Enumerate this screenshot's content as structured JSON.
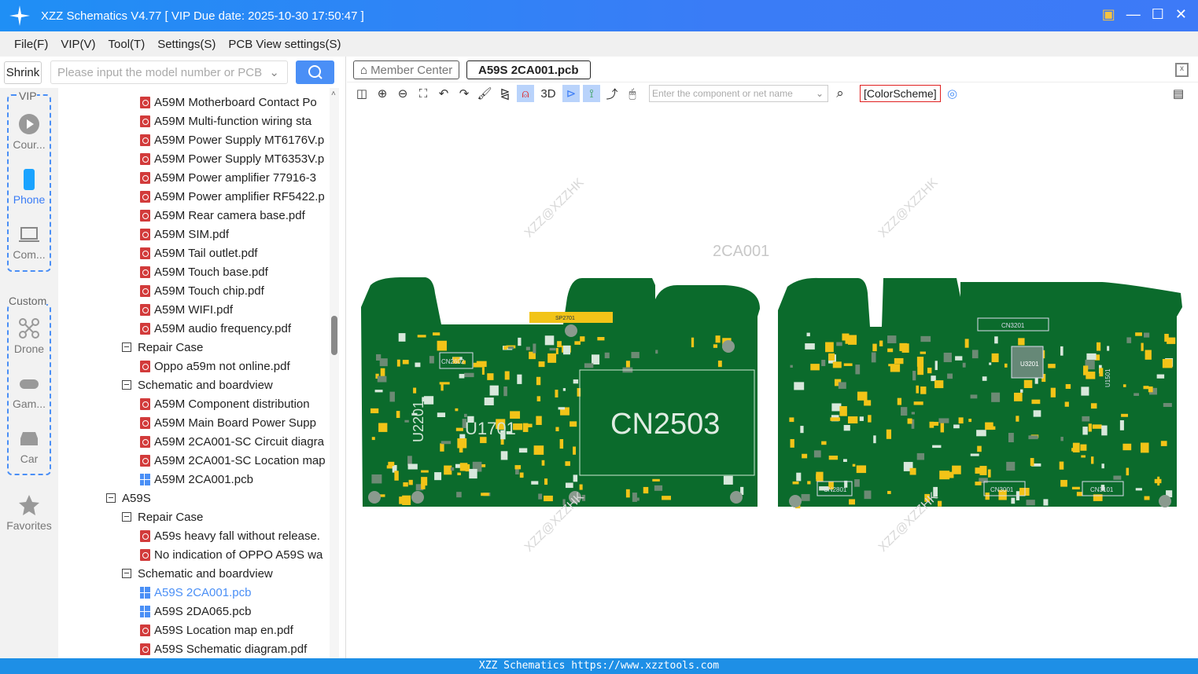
{
  "app": {
    "title": "XZZ Schematics V4.77 [ VIP Due date: 2025-10-30 17:50:47 ]",
    "footer": "XZZ Schematics https://www.xzztools.com"
  },
  "menu": [
    "File(F)",
    "VIP(V)",
    "Tool(T)",
    "Settings(S)",
    "PCB View settings(S)"
  ],
  "left": {
    "shrink": "Shrink",
    "search_placeholder": "Please input the model number or PCB"
  },
  "rail": {
    "vip_label": "VIP",
    "custom_label": "Custom",
    "items": [
      "Cour...",
      "Phone",
      "Com...",
      "Drone",
      "Gam...",
      "Car",
      "Favorites"
    ]
  },
  "tree": [
    {
      "type": "pdf",
      "level": 2,
      "label": "A59M Motherboard Contact Po"
    },
    {
      "type": "pdf",
      "level": 2,
      "label": "A59M Multi-function wiring sta"
    },
    {
      "type": "pdf",
      "level": 2,
      "label": "A59M Power Supply MT6176V.p"
    },
    {
      "type": "pdf",
      "level": 2,
      "label": "A59M Power Supply MT6353V.p"
    },
    {
      "type": "pdf",
      "level": 2,
      "label": "A59M Power amplifier 77916-3"
    },
    {
      "type": "pdf",
      "level": 2,
      "label": "A59M Power amplifier RF5422.p"
    },
    {
      "type": "pdf",
      "level": 2,
      "label": "A59M Rear camera base.pdf"
    },
    {
      "type": "pdf",
      "level": 2,
      "label": "A59M SIM.pdf"
    },
    {
      "type": "pdf",
      "level": 2,
      "label": "A59M Tail outlet.pdf"
    },
    {
      "type": "pdf",
      "level": 2,
      "label": "A59M Touch base.pdf"
    },
    {
      "type": "pdf",
      "level": 2,
      "label": "A59M Touch chip.pdf"
    },
    {
      "type": "pdf",
      "level": 2,
      "label": "A59M WIFI.pdf"
    },
    {
      "type": "pdf",
      "level": 2,
      "label": "A59M audio frequency.pdf"
    },
    {
      "type": "folder",
      "level": 1,
      "label": "Repair Case"
    },
    {
      "type": "pdf",
      "level": 2,
      "label": "Oppo a59m not online.pdf"
    },
    {
      "type": "folder",
      "level": 1,
      "label": "Schematic and boardview"
    },
    {
      "type": "pdf",
      "level": 2,
      "label": "A59M  Component distribution"
    },
    {
      "type": "pdf",
      "level": 2,
      "label": "A59M  Main Board Power Supp"
    },
    {
      "type": "pdf",
      "level": 2,
      "label": "A59M 2CA001-SC Circuit diagra"
    },
    {
      "type": "pdf",
      "level": 2,
      "label": "A59M 2CA001-SC Location map"
    },
    {
      "type": "pcb",
      "level": 2,
      "label": "A59M 2CA001.pcb"
    },
    {
      "type": "folder",
      "level": 0,
      "label": "A59S"
    },
    {
      "type": "folder",
      "level": 1,
      "label": "Repair Case"
    },
    {
      "type": "pdf",
      "level": 2,
      "label": "A59s heavy fall without release."
    },
    {
      "type": "pdf",
      "level": 2,
      "label": "No indication of OPPO A59S wa"
    },
    {
      "type": "folder",
      "level": 1,
      "label": "Schematic and boardview"
    },
    {
      "type": "pcb",
      "level": 2,
      "label": "A59S 2CA001.pcb",
      "selected": true
    },
    {
      "type": "pcb",
      "level": 2,
      "label": "A59S 2DA065.pcb"
    },
    {
      "type": "pdf",
      "level": 2,
      "label": "A59S Location map en.pdf"
    },
    {
      "type": "pdf",
      "level": 2,
      "label": "A59S Schematic diagram.pdf"
    }
  ],
  "tabs": {
    "member": "Member Center",
    "active": "A59S 2CA001.pcb"
  },
  "toolbar": {
    "3d": "3D",
    "net_placeholder": "Enter the component or net name",
    "colorscheme": "[ColorScheme]"
  },
  "pcb": {
    "board_name": "2CA001",
    "watermark": "XZZ@XZZHK",
    "labels": [
      "CN2503",
      "U1701",
      "U2201",
      "SP2701",
      "CN2602",
      "CN3201",
      "U3201",
      "CN2801",
      "CN3001",
      "CN3101",
      "U1501"
    ]
  },
  "colors": {
    "accent": "#3a7cf6",
    "pcb": "#0b6b2c",
    "pad": "#f2c418",
    "selected": "#4a8ff6"
  }
}
